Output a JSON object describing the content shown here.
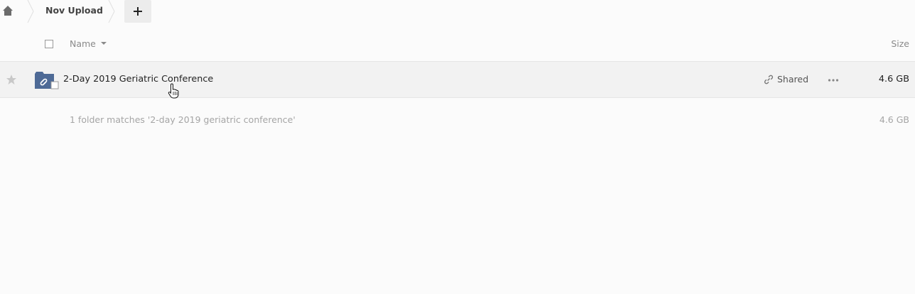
{
  "breadcrumb": {
    "folder_label": "Nov Upload",
    "add_label": "+"
  },
  "header": {
    "name_label": "Name",
    "size_label": "Size"
  },
  "files": [
    {
      "name": "2-Day 2019 Geriatric Conference",
      "share_label": "Shared",
      "size": "4.6 GB",
      "icon": "shared-folder-icon"
    }
  ],
  "summary": {
    "text": "1 folder matches '2-day 2019 geriatric conference'",
    "size": "4.6 GB"
  },
  "colors": {
    "folder": "#4e6a96",
    "row_hover": "#f2f2f2",
    "background": "#fbfbfb"
  }
}
